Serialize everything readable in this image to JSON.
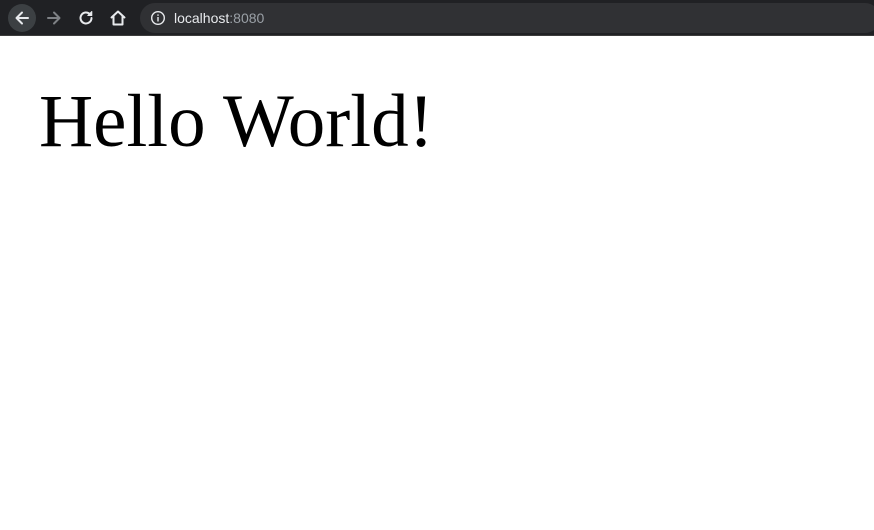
{
  "browser": {
    "url_host": "localhost",
    "url_port": ":8080",
    "icons": {
      "back": "arrow-left-icon",
      "forward": "arrow-right-icon",
      "reload": "reload-icon",
      "home": "home-icon",
      "site_info": "info-icon"
    },
    "colors": {
      "toolbar_bg": "#202124",
      "omnibox_bg": "#303134",
      "host_text": "#e8eaed",
      "port_text": "#9aa0a6"
    }
  },
  "page": {
    "heading": "Hello World!",
    "background": "#ffffff"
  }
}
